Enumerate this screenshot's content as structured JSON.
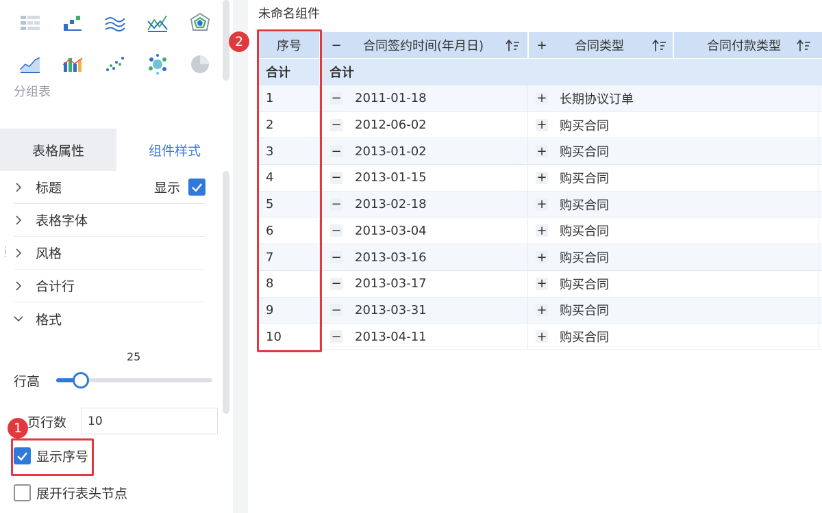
{
  "left_panel": {
    "chart_icons": [
      "grouped-table-icon",
      "bar-chart-icon",
      "area-line-icon",
      "radar-line-icon",
      "radar-chart-icon",
      "trend-line-icon",
      "combo-chart-icon",
      "scatter-chart-icon",
      "bubble-chart-icon",
      "pie-chart-icon"
    ],
    "group_table_label": "分组表",
    "tabs": {
      "table_props": "表格属性",
      "component_style": "组件样式",
      "active": "component_style"
    },
    "sections": {
      "title": "标题",
      "show_label": "显示",
      "show_checked": true,
      "table_font": "表格字体",
      "style": "风格",
      "total_row": "合计行",
      "format": "格式"
    },
    "row_height": {
      "label": "行高",
      "value": "25",
      "fraction": 0.16
    },
    "page_rows": {
      "label": "页行数",
      "value": "10"
    },
    "show_seq": {
      "label": "显示序号",
      "checked": true
    },
    "expand_header": {
      "label": "展开行表头节点",
      "checked": false
    }
  },
  "annotations": {
    "badge1": "1",
    "badge2": "2"
  },
  "component_title": "未命名组件",
  "table": {
    "headers": {
      "seq": "序号",
      "sign_date": "合同签约时间(年月日)",
      "contract_type": "合同类型",
      "payment_type": "合同付款类型"
    },
    "total_row": {
      "seq": "合计",
      "value": "合计"
    },
    "rows": [
      {
        "seq": "1",
        "date": "2011-01-18",
        "type": "长期协议订单"
      },
      {
        "seq": "2",
        "date": "2012-06-02",
        "type": "购买合同"
      },
      {
        "seq": "3",
        "date": "2013-01-02",
        "type": "购买合同"
      },
      {
        "seq": "4",
        "date": "2013-01-15",
        "type": "购买合同"
      },
      {
        "seq": "5",
        "date": "2013-02-18",
        "type": "购买合同"
      },
      {
        "seq": "6",
        "date": "2013-03-04",
        "type": "购买合同"
      },
      {
        "seq": "7",
        "date": "2013-03-16",
        "type": "购买合同"
      },
      {
        "seq": "8",
        "date": "2013-03-17",
        "type": "购买合同"
      },
      {
        "seq": "9",
        "date": "2013-03-31",
        "type": "购买合同"
      },
      {
        "seq": "10",
        "date": "2013-04-11",
        "type": "购买合同"
      }
    ],
    "minus_sign": "−",
    "plus_sign": "+"
  },
  "colors": {
    "accent": "#2f7ad8",
    "annotation": "#e0393e",
    "header_bg": "#cfe0f6"
  }
}
